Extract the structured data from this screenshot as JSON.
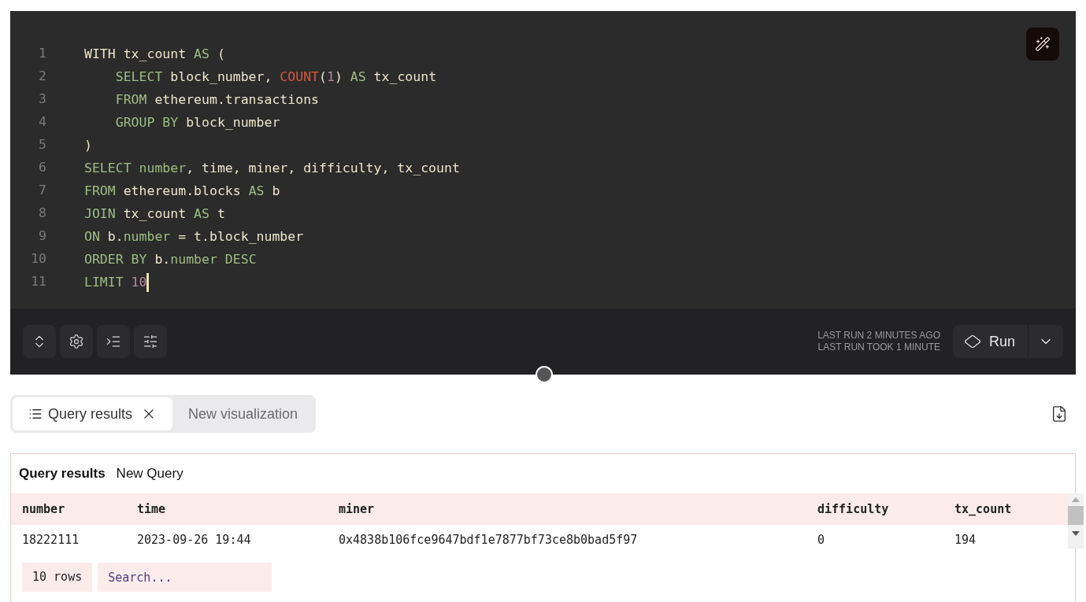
{
  "editor": {
    "lines": [
      {
        "number": "1",
        "cursor": false,
        "tokens": [
          {
            "kind": "id",
            "text": "WITH tx_count "
          },
          {
            "kind": "kw",
            "text": "AS"
          },
          {
            "kind": "id",
            "text": " ("
          }
        ]
      },
      {
        "number": "2",
        "cursor": false,
        "tokens": [
          {
            "kind": "kw",
            "text": "    SELECT"
          },
          {
            "kind": "id",
            "text": " block_number, "
          },
          {
            "kind": "fn",
            "text": "COUNT"
          },
          {
            "kind": "id",
            "text": "("
          },
          {
            "kind": "num",
            "text": "1"
          },
          {
            "kind": "id",
            "text": ") "
          },
          {
            "kind": "kw",
            "text": "AS"
          },
          {
            "kind": "id",
            "text": " tx_count"
          }
        ]
      },
      {
        "number": "3",
        "cursor": false,
        "tokens": [
          {
            "kind": "kw",
            "text": "    FROM"
          },
          {
            "kind": "id",
            "text": " ethereum.transactions"
          }
        ]
      },
      {
        "number": "4",
        "cursor": false,
        "tokens": [
          {
            "kind": "kw",
            "text": "    GROUP BY"
          },
          {
            "kind": "id",
            "text": " block_number"
          }
        ]
      },
      {
        "number": "5",
        "cursor": false,
        "tokens": [
          {
            "kind": "id",
            "text": ")"
          }
        ]
      },
      {
        "number": "6",
        "cursor": false,
        "tokens": [
          {
            "kind": "kw",
            "text": "SELECT number"
          },
          {
            "kind": "id",
            "text": ", time, miner, difficulty, tx_count"
          }
        ]
      },
      {
        "number": "7",
        "cursor": false,
        "tokens": [
          {
            "kind": "kw",
            "text": "FROM"
          },
          {
            "kind": "id",
            "text": " ethereum.blocks "
          },
          {
            "kind": "kw",
            "text": "AS"
          },
          {
            "kind": "id",
            "text": " b"
          }
        ]
      },
      {
        "number": "8",
        "cursor": false,
        "tokens": [
          {
            "kind": "kw",
            "text": "JOIN"
          },
          {
            "kind": "id",
            "text": " tx_count "
          },
          {
            "kind": "kw",
            "text": "AS"
          },
          {
            "kind": "id",
            "text": " t"
          }
        ]
      },
      {
        "number": "9",
        "cursor": false,
        "tokens": [
          {
            "kind": "kw",
            "text": "ON"
          },
          {
            "kind": "id",
            "text": " b."
          },
          {
            "kind": "kw",
            "text": "number"
          },
          {
            "kind": "id",
            "text": " = t.block_number"
          }
        ]
      },
      {
        "number": "10",
        "cursor": false,
        "tokens": [
          {
            "kind": "kw",
            "text": "ORDER BY"
          },
          {
            "kind": "id",
            "text": " b."
          },
          {
            "kind": "kw",
            "text": "number DESC"
          }
        ]
      },
      {
        "number": "11",
        "cursor": true,
        "tokens": [
          {
            "kind": "kw",
            "text": "LIMIT "
          },
          {
            "kind": "num",
            "text": "10"
          }
        ]
      }
    ]
  },
  "toolbar": {
    "status": [
      "LAST RUN 2 MINUTES AGO",
      "LAST RUN TOOK 1 MINUTE"
    ],
    "run_label": "Run"
  },
  "tabs": [
    {
      "label": "Query results",
      "selected": true,
      "closable": true
    },
    {
      "label": "New visualization",
      "selected": false,
      "closable": false
    }
  ],
  "results": {
    "title": "Query results",
    "subtitle": "New Query",
    "columns": [
      "number",
      "time",
      "miner",
      "difficulty",
      "tx_count"
    ],
    "rows": [
      [
        "18222111",
        "2023-09-26 19:44",
        "0x4838b106fce9647bdf1e7877bf73ce8b0bad5f97",
        "0",
        "194"
      ]
    ],
    "row_count": "10 rows",
    "search": {
      "placeholder": "Search..."
    }
  }
}
